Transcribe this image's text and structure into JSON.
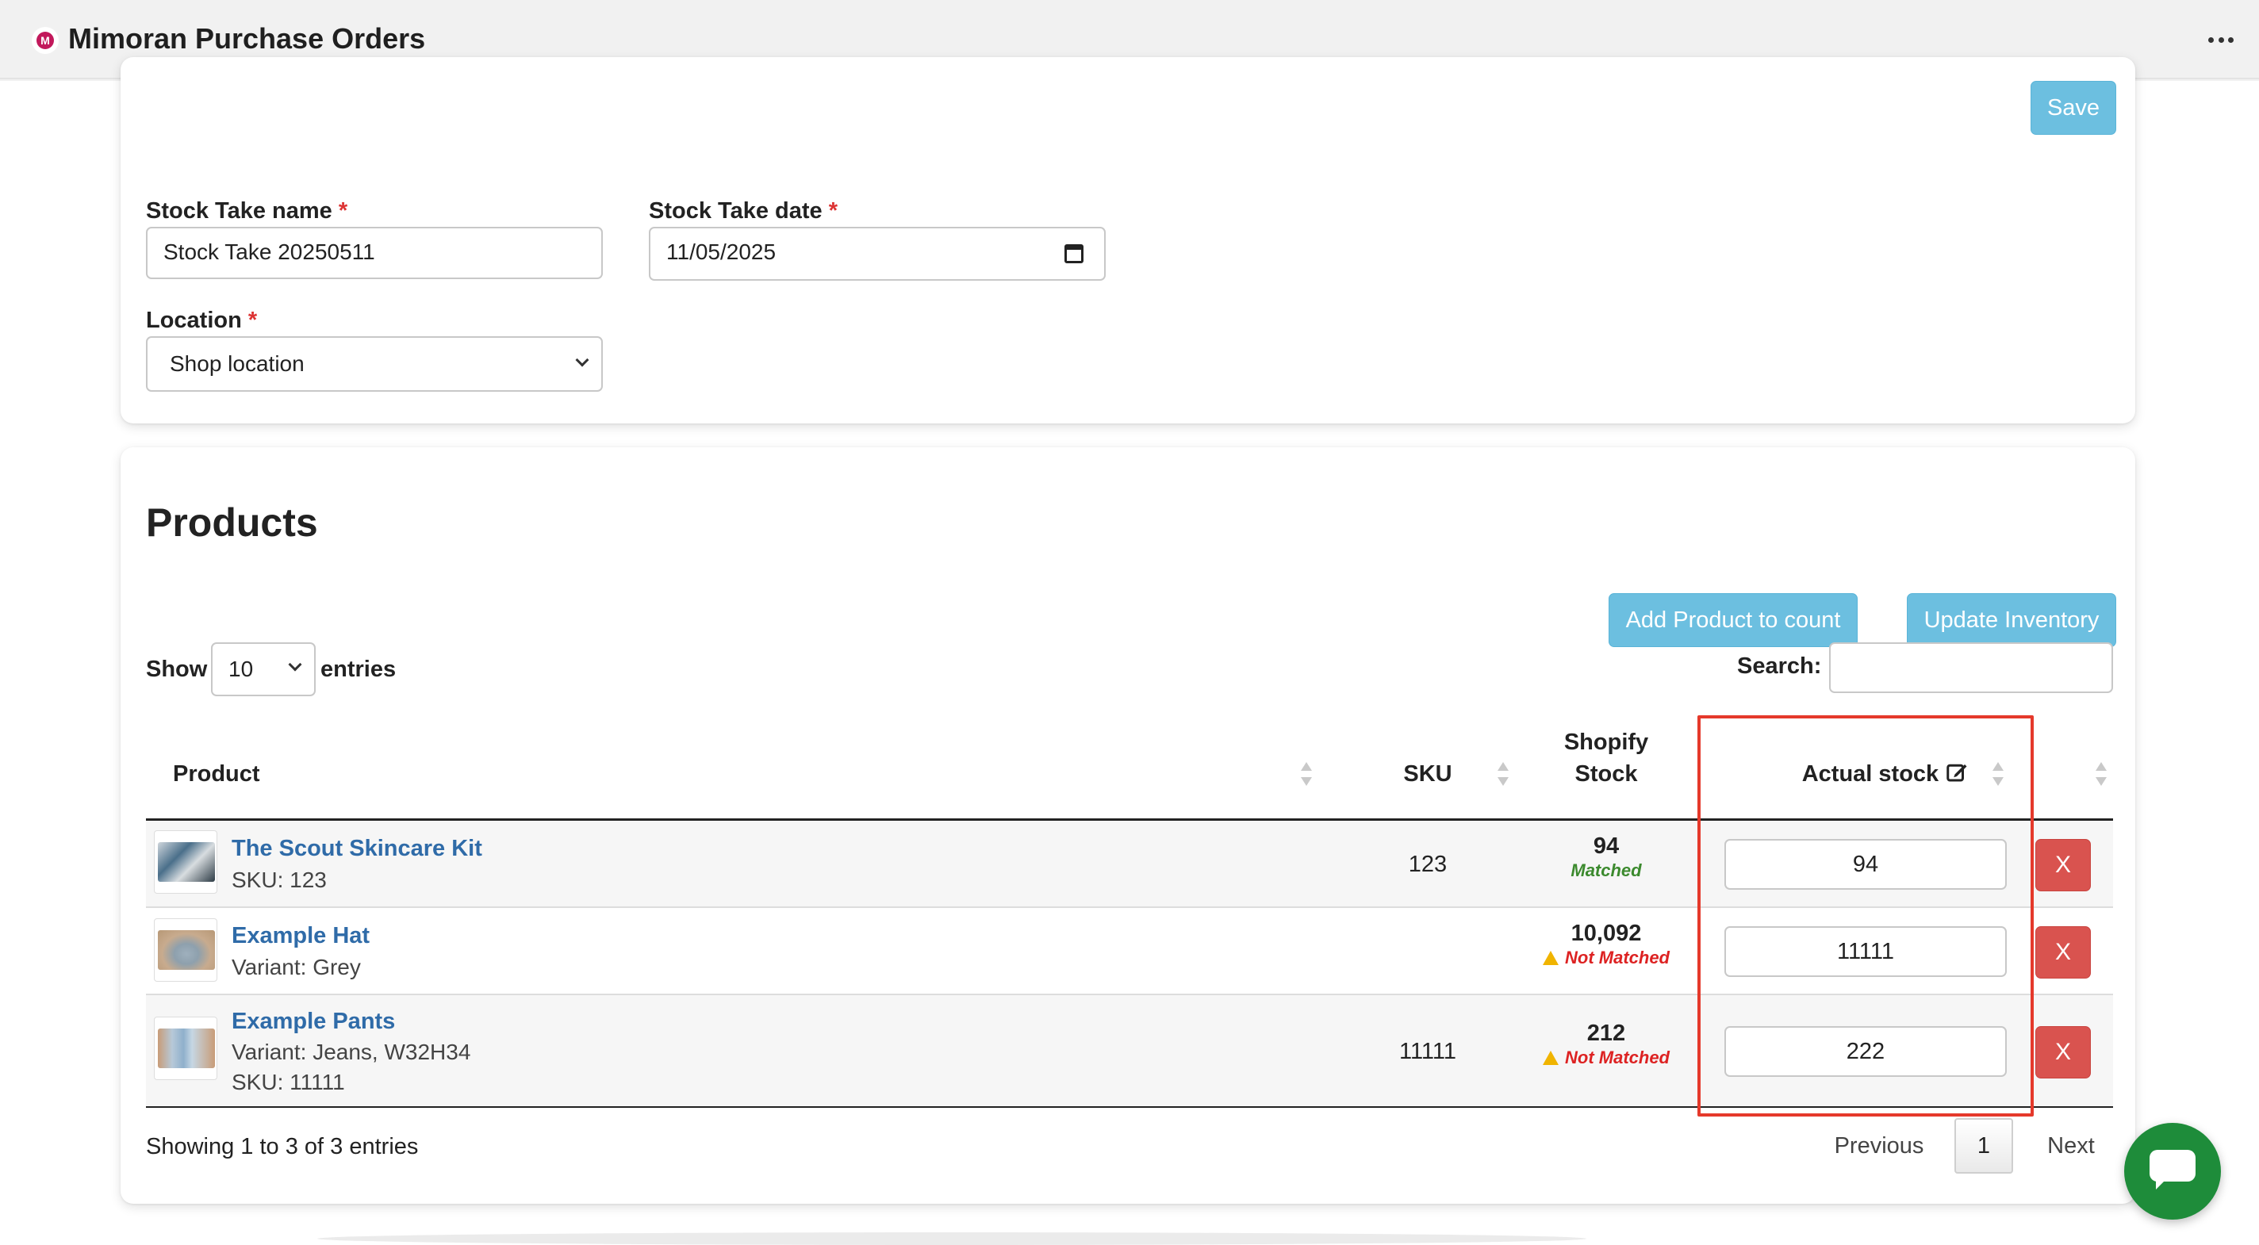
{
  "app": {
    "title": "Mimoran Purchase Orders",
    "logo_letter": "M"
  },
  "form": {
    "save_label": "Save",
    "name_label": "Stock Take name",
    "name_value": "Stock Take 20250511",
    "date_label": "Stock Take date",
    "date_value": "11/05/2025",
    "location_label": "Location",
    "location_value": "Shop location",
    "required_mark": "*"
  },
  "products": {
    "title": "Products",
    "add_label": "Add Product to count",
    "update_label": "Update Inventory",
    "show_label": "Show",
    "entries_value": "10",
    "entries_label": "entries",
    "search_label": "Search:",
    "search_value": "",
    "columns": {
      "product": "Product",
      "sku": "SKU",
      "shopify_stock_line1": "Shopify",
      "shopify_stock_line2": "Stock",
      "actual_stock": "Actual stock"
    },
    "rows": [
      {
        "name": "The Scout Skincare Kit",
        "line1": "SKU: 123",
        "line2": "",
        "sku": "123",
        "shopify_stock": "94",
        "status": "Matched",
        "actual": "94",
        "delete": "X"
      },
      {
        "name": "Example Hat",
        "line1": "Variant: Grey",
        "line2": "",
        "sku": "",
        "shopify_stock": "10,092",
        "status": "Not Matched",
        "actual": "11111",
        "delete": "X"
      },
      {
        "name": "Example Pants",
        "line1": "Variant: Jeans, W32H34",
        "line2": "SKU: 11111",
        "sku": "11111",
        "shopify_stock": "212",
        "status": "Not Matched",
        "actual": "222",
        "delete": "X"
      }
    ],
    "info": "Showing 1 to 3 of 3 entries",
    "pagination": {
      "previous": "Previous",
      "current": "1",
      "next": "Next"
    }
  },
  "colors": {
    "accent_button": "#6cbfe0",
    "link": "#2f6ba8",
    "danger": "#d9534f",
    "matched": "#3c8a2e",
    "not_matched": "#d22",
    "highlight": "#e5392b",
    "chat": "#1e8c3a"
  },
  "icons": [
    "more-icon",
    "calendar-icon",
    "chevron-down-icon",
    "edit-icon",
    "sort-icon",
    "warning-icon",
    "chat-icon"
  ]
}
